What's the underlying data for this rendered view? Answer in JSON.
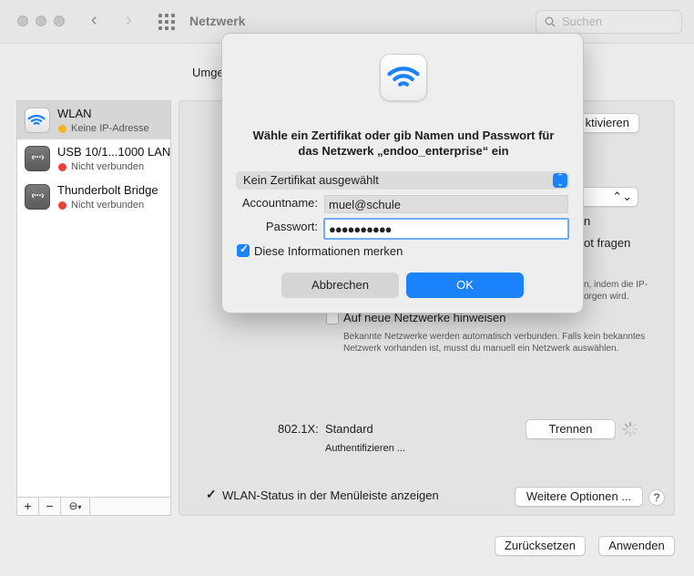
{
  "window": {
    "title": "Netzwerk",
    "search_placeholder": "Suchen",
    "location_label": "Umge"
  },
  "sidebar": {
    "items": [
      {
        "name": "WLAN",
        "status": "Keine IP-Adresse",
        "status_color": "#f5b323",
        "icon": "wifi-icon"
      },
      {
        "name": "USB 10/1...1000 LAN",
        "status": "Nicht verbunden",
        "status_color": "#e8413b",
        "icon": "ethernet-icon"
      },
      {
        "name": "Thunderbolt Bridge",
        "status": "Nicht verbunden",
        "status_color": "#e8413b",
        "icon": "ethernet-icon"
      }
    ],
    "toolbar": {
      "add": "+",
      "remove": "−",
      "action": "⊖"
    }
  },
  "panel": {
    "deactivate_partial": "ktivieren",
    "right_fragment_1": "n",
    "right_fragment_2": "ot fragen",
    "right_note_1": "n, indem die IP-",
    "right_note_2": "orgen wird.",
    "notify_label": "Auf neue Netzwerke hinweisen",
    "notify_description": "Bekannte Netzwerke werden automatisch verbunden. Falls kein bekanntes Netzwerk vorhanden ist, musst du manuell ein Netzwerk auswählen.",
    "dot1x_label": "802.1X:",
    "dot1x_value": "Standard",
    "dot1x_status": "Authentifizieren ...",
    "disconnect_button": "Trennen",
    "menubar_label": "WLAN-Status in der Menüleiste anzeigen",
    "advanced_button": "Weitere Optionen ...",
    "help": "?"
  },
  "footer": {
    "revert_button": "Zurücksetzen",
    "apply_button": "Anwenden"
  },
  "dialog": {
    "title_line1": "Wähle ein Zertifikat oder gib Namen und Passwort für",
    "title_line2": "das Netzwerk „endoo_enterprise“ ein",
    "certificate_value": "Kein Zertifikat ausgewählt",
    "account_label": "Accountname:",
    "account_value": "muel@schule",
    "password_label": "Passwort:",
    "password_value": "●●●●●●●●●●",
    "remember_label": "Diese Informationen merken",
    "remember_checked": true,
    "cancel_button": "Abbrechen",
    "ok_button": "OK"
  },
  "colors": {
    "accent": "#1a82fb",
    "warning": "#f5b323",
    "error": "#e8413b"
  }
}
